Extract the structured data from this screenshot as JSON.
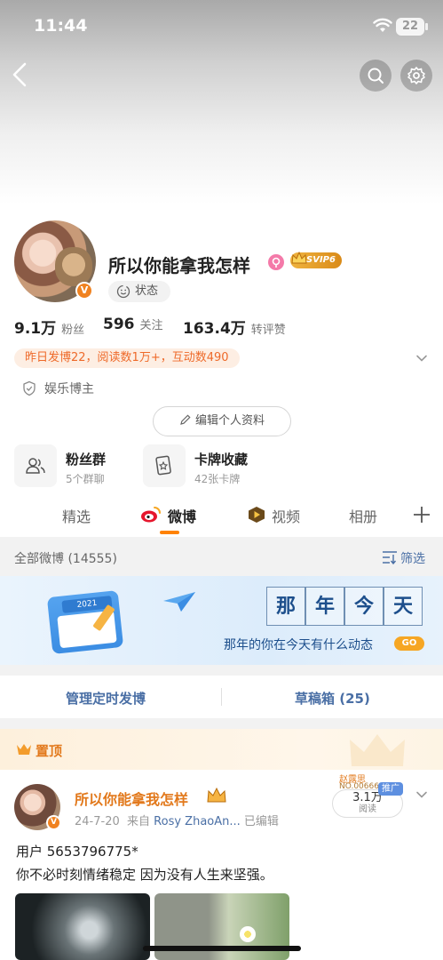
{
  "status_bar": {
    "time": "11:44",
    "battery": "22"
  },
  "profile": {
    "name": "所以你能拿我怎样",
    "vip_badge": "SVIP6",
    "status_label": "状态",
    "verified_badge": "V",
    "stats": [
      {
        "value": "9.1万",
        "label": "粉丝"
      },
      {
        "value": "596",
        "label": "关注"
      },
      {
        "value": "163.4万",
        "label": "转评赞"
      }
    ],
    "activity_summary": "昨日发博22，阅读数1万+，互动数490",
    "role": "娱乐博主",
    "edit_button": "编辑个人资料"
  },
  "features": [
    {
      "title": "粉丝群",
      "subtitle": "5个群聊",
      "icon": "fan-group-icon"
    },
    {
      "title": "卡牌收藏",
      "subtitle": "42张卡牌",
      "icon": "card-collection-icon"
    }
  ],
  "tabs": [
    {
      "label": "精选"
    },
    {
      "label": "微博",
      "active": true
    },
    {
      "label": "视频"
    },
    {
      "label": "相册"
    }
  ],
  "posts_header": {
    "all_label": "全部微博 (14555)",
    "filter_label": "筛选"
  },
  "banner": {
    "calendar_year": "2021",
    "chars": [
      "那",
      "年",
      "今",
      "天"
    ],
    "subtitle": "那年的你在今天有什么动态",
    "go_label": "GO"
  },
  "actions": {
    "scheduled": "管理定时发博",
    "drafts": "草稿箱 (25)"
  },
  "pinned": {
    "label": "置顶"
  },
  "post": {
    "author": "所以你能拿我怎样",
    "date": "24-7-20",
    "source_prefix": "来自",
    "source": "Rosy ZhaoAn...",
    "edited": "已编辑",
    "read_count": "3.1万",
    "read_label": "阅读",
    "promo": "推广",
    "badge_name": "赵露思",
    "badge_no": "NO.006667",
    "lines": [
      "用户 5653796775*",
      "你不必时刻情绪稳定   因为没有人生来坚强。"
    ]
  },
  "colors": {
    "accent": "#ff8200",
    "link": "#4a6fa5",
    "verified": "#f08220"
  }
}
